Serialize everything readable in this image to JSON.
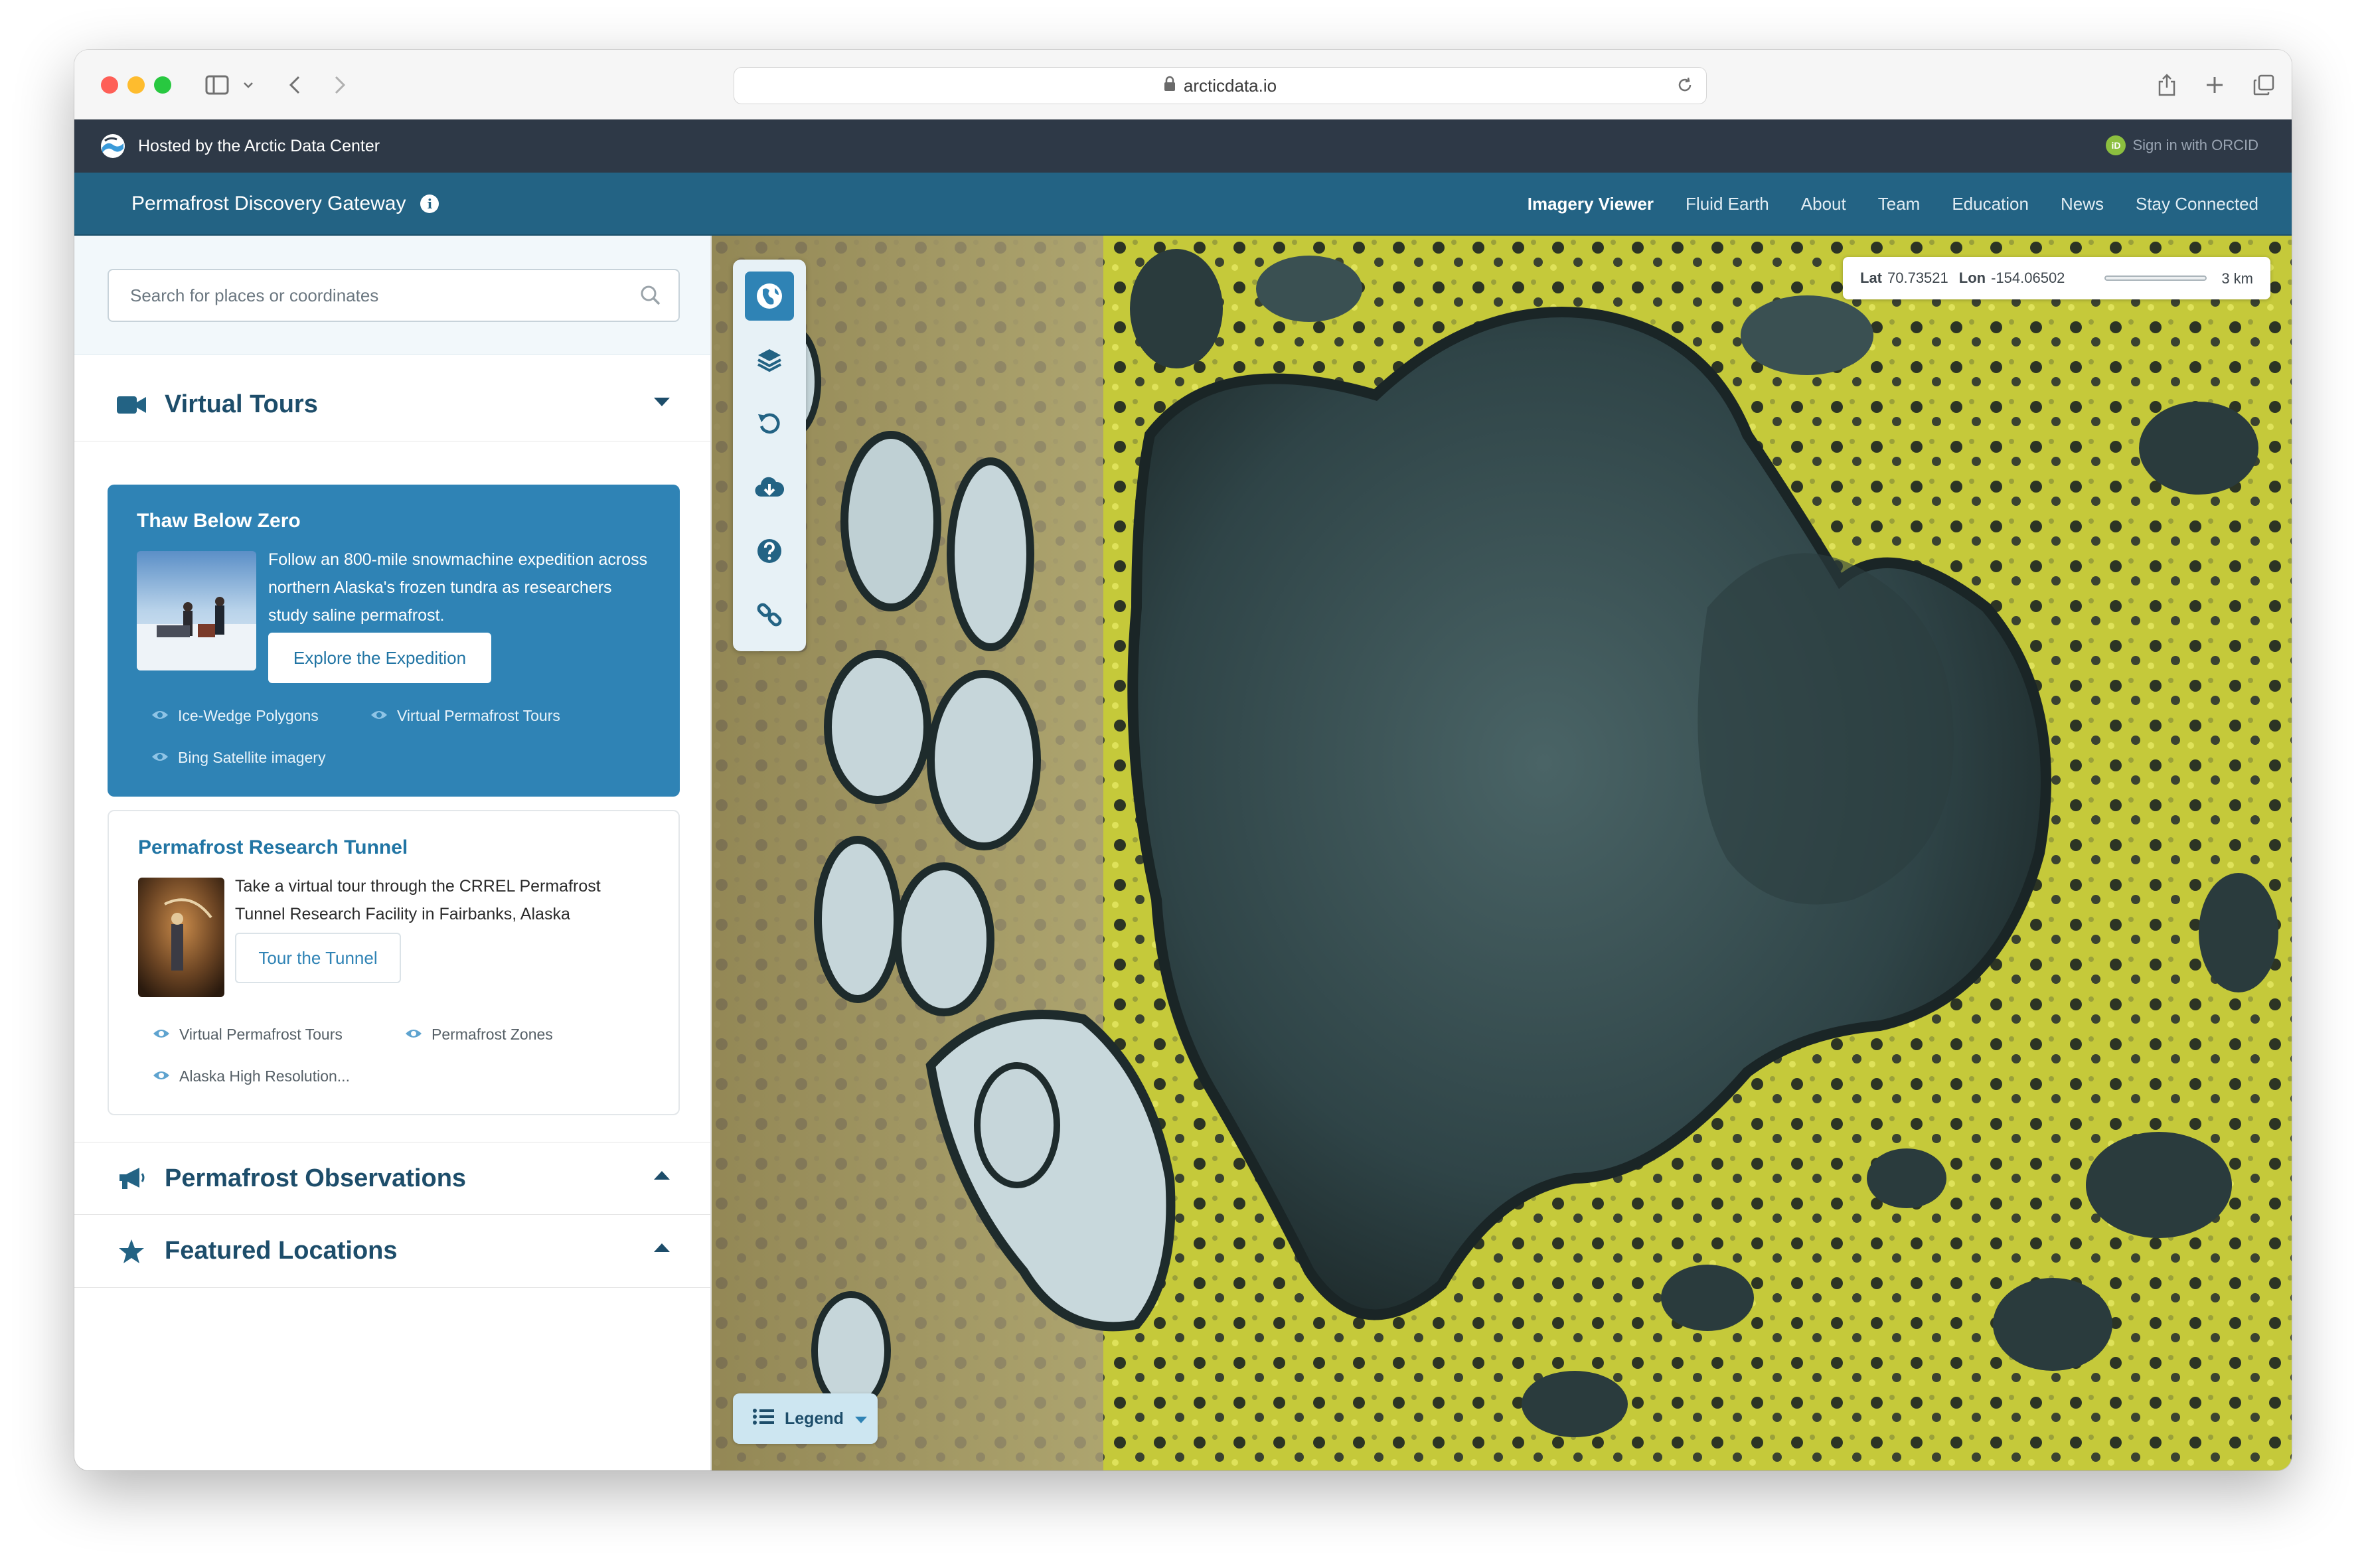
{
  "browser": {
    "url": "arcticdata.io"
  },
  "hostbar": {
    "text": "Hosted by the Arctic Data Center",
    "signin": "Sign in with ORCID",
    "orcid_badge": "iD"
  },
  "navbar": {
    "brand": "Permafrost Discovery Gateway",
    "links": [
      {
        "label": "Imagery Viewer",
        "active": true
      },
      {
        "label": "Fluid Earth"
      },
      {
        "label": "About"
      },
      {
        "label": "Team"
      },
      {
        "label": "Education"
      },
      {
        "label": "News"
      },
      {
        "label": "Stay Connected"
      }
    ]
  },
  "sidebar": {
    "search": {
      "placeholder": "Search for places or coordinates"
    },
    "sections": [
      {
        "title": "Virtual Tours",
        "icon": "video-camera-icon",
        "expanded": true
      },
      {
        "title": "Permafrost Observations",
        "icon": "megaphone-icon",
        "expanded": false
      },
      {
        "title": "Featured Locations",
        "icon": "star-icon",
        "expanded": false
      }
    ],
    "tours": [
      {
        "title": "Thaw Below Zero",
        "description": "Follow an 800-mile snowmachine expedition across northern Alaska's frozen tundra as researchers study saline permafrost.",
        "button": "Explore the Expedition",
        "layers": [
          "Ice-Wedge Polygons",
          "Virtual Permafrost Tours",
          "Bing Satellite imagery"
        ]
      },
      {
        "title": "Permafrost Research Tunnel",
        "description": "Take a virtual tour through the CRREL Permafrost Tunnel Research Facility in Fairbanks, Alaska",
        "button": "Tour the Tunnel",
        "layers": [
          "Virtual Permafrost Tours",
          "Permafrost Zones",
          "Alaska High Resolution..."
        ]
      }
    ]
  },
  "map": {
    "toolbar": [
      "globe-icon",
      "layers-icon",
      "reset-icon",
      "download-icon",
      "help-icon",
      "link-icon"
    ],
    "coords": {
      "lat_label": "Lat",
      "lat": "70.73521",
      "lon_label": "Lon",
      "lon": "-154.06502",
      "scale": "3 km"
    },
    "legend": "Legend"
  },
  "colors": {
    "navbar": "#236384",
    "hostbar": "#2e3947",
    "accent": "#2f83b5",
    "heading": "#1d4d6a"
  }
}
